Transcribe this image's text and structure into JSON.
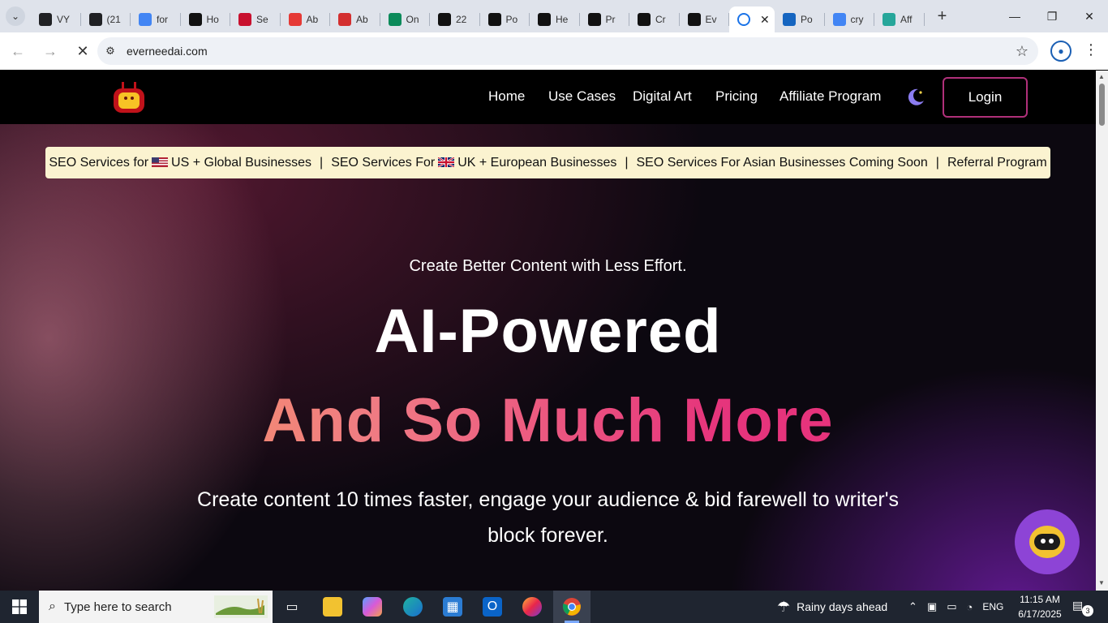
{
  "browser": {
    "tabs": [
      {
        "label": "VY",
        "icon": "openai-icon",
        "color": "#202124"
      },
      {
        "label": "(21",
        "icon": "quora-icon",
        "color": "#202124"
      },
      {
        "label": "for",
        "icon": "google-icon",
        "color": "#4285f4"
      },
      {
        "label": "Ho",
        "icon": "blogger-b-icon",
        "color": "#111111"
      },
      {
        "label": "Se",
        "icon": "x-icon",
        "color": "#c8102e"
      },
      {
        "label": "Ab",
        "icon": "sgt-icon",
        "color": "#e53935"
      },
      {
        "label": "Ab",
        "icon": "simplefx-icon",
        "color": "#d32f2f"
      },
      {
        "label": "On",
        "icon": "dollar-icon",
        "color": "#0b8a5a"
      },
      {
        "label": "22",
        "icon": "a-icon",
        "color": "#111111"
      },
      {
        "label": "Po",
        "icon": "a-icon",
        "color": "#111111"
      },
      {
        "label": "He",
        "icon": "a-icon",
        "color": "#111111"
      },
      {
        "label": "Pr",
        "icon": "a-icon",
        "color": "#111111"
      },
      {
        "label": "Cr",
        "icon": "a-icon",
        "color": "#111111"
      },
      {
        "label": "Ev",
        "icon": "a-icon",
        "color": "#111111"
      }
    ],
    "active_tab": {
      "icon": "loading-icon",
      "close": "✕"
    },
    "tabs_after": [
      {
        "label": "Po",
        "icon": "xf-icon",
        "color": "#1565c0"
      },
      {
        "label": "cry",
        "icon": "google-icon",
        "color": "#4285f4"
      },
      {
        "label": "Aff",
        "icon": "aff-icon",
        "color": "#26a69a"
      }
    ],
    "url": "everneedai.com"
  },
  "site": {
    "nav": [
      "Home",
      "Use Cases",
      "Digital Art",
      "Pricing",
      "Affiliate Program"
    ],
    "login": "Login",
    "banner": {
      "item1_pre": "SEO Services for",
      "item1_post": "US + Global Businesses",
      "item2_pre": "SEO Services For",
      "item2_post": "UK + European Businesses",
      "item3": "SEO Services For Asian Businesses Coming Soon",
      "item4": "Referral Program",
      "separator": "|"
    },
    "kicker": "Create Better Content with Less Effort.",
    "headline1": "AI-Powered",
    "headline2": "And So Much More",
    "subtext": "Create content 10 times faster, engage your audience & bid farewell to writer's block forever.",
    "accent": "#e42d7a"
  },
  "taskbar": {
    "search_placeholder": "Type here to search",
    "weather": "Rainy days ahead",
    "language": "ENG",
    "time": "11:15 AM",
    "date": "6/17/2025",
    "notifications": "3"
  }
}
